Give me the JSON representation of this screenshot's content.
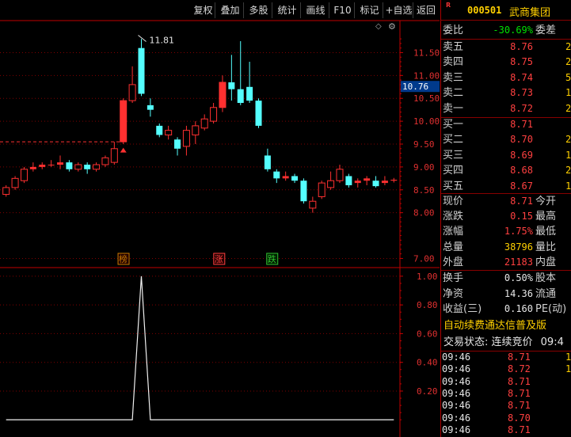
{
  "toolbar": {
    "buttons": [
      "复权",
      "叠加",
      "多股",
      "统计",
      "画线",
      "F10",
      "标记",
      "+自选",
      "返回"
    ]
  },
  "quote": {
    "badge": "R",
    "code": "000501",
    "name": "武商集团",
    "weibi_label": "委比",
    "weibi_value": "-30.69%",
    "weicha_label": "委差",
    "sell": [
      {
        "label": "卖五",
        "price": "8.76",
        "vol": "2"
      },
      {
        "label": "卖四",
        "price": "8.75",
        "vol": "2"
      },
      {
        "label": "卖三",
        "price": "8.74",
        "vol": "5"
      },
      {
        "label": "卖二",
        "price": "8.73",
        "vol": "1"
      },
      {
        "label": "卖一",
        "price": "8.72",
        "vol": "2"
      }
    ],
    "buy": [
      {
        "label": "买一",
        "price": "8.71",
        "vol": ""
      },
      {
        "label": "买二",
        "price": "8.70",
        "vol": "2"
      },
      {
        "label": "买三",
        "price": "8.69",
        "vol": "1"
      },
      {
        "label": "买四",
        "price": "8.68",
        "vol": "2"
      },
      {
        "label": "买五",
        "price": "8.67",
        "vol": "1"
      }
    ],
    "stats": [
      {
        "l1": "现价",
        "v": "8.71",
        "vc": "red",
        "l2": "今开"
      },
      {
        "l1": "涨跌",
        "v": "0.15",
        "vc": "red",
        "l2": "最高"
      },
      {
        "l1": "涨幅",
        "v": "1.75%",
        "vc": "red",
        "l2": "最低"
      },
      {
        "l1": "总量",
        "v": "38796",
        "vc": "yellow",
        "l2": "量比"
      },
      {
        "l1": "外盘",
        "v": "21183",
        "vc": "red",
        "l2": "内盘"
      }
    ],
    "stats2": [
      {
        "l1": "换手",
        "v": "0.50%",
        "l2": "股本"
      },
      {
        "l1": "净资",
        "v": "14.36",
        "l2": "流通"
      },
      {
        "l1": "收益(三)",
        "v": "0.160",
        "l2": "PE(动)"
      }
    ],
    "banner": "自动续费通达信普及版",
    "status": "交易状态: 连续竞价",
    "status_time": "09:4",
    "ticks": [
      {
        "time": "09:46",
        "price": "8.71",
        "vol": "1"
      },
      {
        "time": "09:46",
        "price": "8.72",
        "vol": "1"
      },
      {
        "time": "09:46",
        "price": "8.71",
        "vol": ""
      },
      {
        "time": "09:46",
        "price": "8.71",
        "vol": ""
      },
      {
        "time": "09:46",
        "price": "8.71",
        "vol": ""
      },
      {
        "time": "09:46",
        "price": "8.70",
        "vol": ""
      },
      {
        "time": "09:46",
        "price": "8.71",
        "vol": ""
      }
    ]
  },
  "chart_data": [
    {
      "type": "candlestick",
      "y_ticks": [
        "11.50",
        "11.00",
        "10.50",
        "10.00",
        "9.50",
        "9.00",
        "8.50",
        "8.00",
        "7.00"
      ],
      "ylim": [
        6.8,
        12.2
      ],
      "cursor_price": "10.76",
      "high_label": "11.81",
      "markers": [
        "榜",
        "涨",
        "跌"
      ],
      "candles": [
        {
          "o": 8.4,
          "c": 8.55,
          "h": 8.6,
          "l": 8.35
        },
        {
          "o": 8.55,
          "c": 8.75,
          "h": 8.8,
          "l": 8.5
        },
        {
          "o": 8.7,
          "c": 8.95,
          "h": 9.0,
          "l": 8.65
        },
        {
          "o": 8.95,
          "c": 9.0,
          "h": 9.1,
          "l": 8.9
        },
        {
          "o": 9.0,
          "c": 9.05,
          "h": 9.1,
          "l": 8.95
        },
        {
          "o": 9.05,
          "c": 9.05,
          "h": 9.15,
          "l": 9.0
        },
        {
          "o": 9.05,
          "c": 9.1,
          "h": 9.25,
          "l": 8.95
        },
        {
          "o": 9.1,
          "c": 8.95,
          "h": 9.15,
          "l": 8.9
        },
        {
          "o": 8.95,
          "c": 9.05,
          "h": 9.1,
          "l": 8.9
        },
        {
          "o": 9.05,
          "c": 8.95,
          "h": 9.1,
          "l": 8.85
        },
        {
          "o": 8.95,
          "c": 9.05,
          "h": 9.1,
          "l": 8.9
        },
        {
          "o": 9.05,
          "c": 9.2,
          "h": 9.25,
          "l": 9.0
        },
        {
          "o": 9.1,
          "c": 9.4,
          "h": 9.55,
          "l": 9.05
        },
        {
          "o": 9.55,
          "c": 10.45,
          "h": 10.5,
          "l": 9.5
        },
        {
          "o": 10.45,
          "c": 10.8,
          "h": 11.2,
          "l": 10.4
        },
        {
          "o": 11.6,
          "c": 10.6,
          "h": 11.8,
          "l": 10.55
        },
        {
          "o": 10.35,
          "c": 10.25,
          "h": 10.5,
          "l": 10.1
        },
        {
          "o": 9.9,
          "c": 9.7,
          "h": 9.95,
          "l": 9.65
        },
        {
          "o": 9.7,
          "c": 9.8,
          "h": 9.9,
          "l": 9.6
        },
        {
          "o": 9.6,
          "c": 9.4,
          "h": 9.65,
          "l": 9.25
        },
        {
          "o": 9.45,
          "c": 9.8,
          "h": 9.9,
          "l": 9.25
        },
        {
          "o": 9.7,
          "c": 9.9,
          "h": 10.0,
          "l": 9.5
        },
        {
          "o": 9.85,
          "c": 10.05,
          "h": 10.15,
          "l": 9.8
        },
        {
          "o": 10.0,
          "c": 10.3,
          "h": 10.4,
          "l": 9.95
        },
        {
          "o": 10.3,
          "c": 10.85,
          "h": 11.0,
          "l": 10.2
        },
        {
          "o": 10.85,
          "c": 10.7,
          "h": 11.45,
          "l": 10.45
        },
        {
          "o": 10.7,
          "c": 10.4,
          "h": 11.75,
          "l": 10.35
        },
        {
          "o": 10.75,
          "c": 10.45,
          "h": 11.3,
          "l": 10.4
        },
        {
          "o": 10.45,
          "c": 9.9,
          "h": 10.5,
          "l": 9.85
        },
        {
          "o": 9.25,
          "c": 8.95,
          "h": 9.4,
          "l": 8.9
        },
        {
          "o": 8.9,
          "c": 8.75,
          "h": 8.95,
          "l": 8.65
        },
        {
          "o": 8.75,
          "c": 8.8,
          "h": 8.9,
          "l": 8.7
        },
        {
          "o": 8.8,
          "c": 8.7,
          "h": 8.85,
          "l": 8.65
        },
        {
          "o": 8.7,
          "c": 8.25,
          "h": 8.75,
          "l": 8.2
        },
        {
          "o": 8.1,
          "c": 8.25,
          "h": 8.35,
          "l": 8.0
        },
        {
          "o": 8.35,
          "c": 8.65,
          "h": 8.7,
          "l": 8.3
        },
        {
          "o": 8.55,
          "c": 8.7,
          "h": 8.9,
          "l": 8.5
        },
        {
          "o": 8.7,
          "c": 8.95,
          "h": 9.05,
          "l": 8.65
        },
        {
          "o": 8.8,
          "c": 8.6,
          "h": 8.85,
          "l": 8.55
        },
        {
          "o": 8.65,
          "c": 8.7,
          "h": 8.75,
          "l": 8.55
        },
        {
          "o": 8.7,
          "c": 8.75,
          "h": 8.8,
          "l": 8.6
        },
        {
          "o": 8.7,
          "c": 8.58,
          "h": 8.8,
          "l": 8.55
        },
        {
          "o": 8.65,
          "c": 8.7,
          "h": 8.8,
          "l": 8.6
        },
        {
          "o": 8.7,
          "c": 8.72,
          "h": 8.76,
          "l": 8.66
        }
      ]
    },
    {
      "type": "line",
      "y_ticks": [
        "1.00",
        "0.80",
        "0.60",
        "0.40",
        "0.20"
      ],
      "ylim": [
        -0.12,
        1.06
      ],
      "values": [
        0,
        0,
        0,
        0,
        0,
        0,
        0,
        0,
        0,
        0,
        0,
        0,
        0,
        0,
        0,
        1,
        0,
        0,
        0,
        0,
        0,
        0,
        0,
        0,
        0,
        0,
        0,
        0,
        0,
        0,
        0,
        0,
        0,
        0,
        0,
        0,
        0,
        0,
        0,
        0,
        0,
        0,
        0,
        0
      ]
    }
  ],
  "colors": {
    "up": "#ff3030",
    "down": "#54ffff",
    "grid": "#800000",
    "axis": "#c00000"
  }
}
